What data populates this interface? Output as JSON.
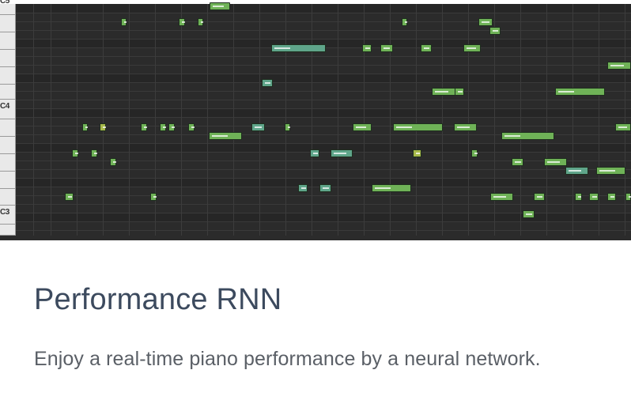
{
  "card": {
    "title": "Performance RNN",
    "description": "Enjoy a real-time piano performance by a neural network."
  },
  "piano_roll": {
    "octave_labels": [
      "C5",
      "C4",
      "C3"
    ],
    "colors": {
      "background": "#2b2b2b",
      "note_green": "#6fb257",
      "note_teal": "#5fa58a",
      "note_olive": "#a6b84a",
      "keyboard": "#e9e9e9"
    }
  }
}
